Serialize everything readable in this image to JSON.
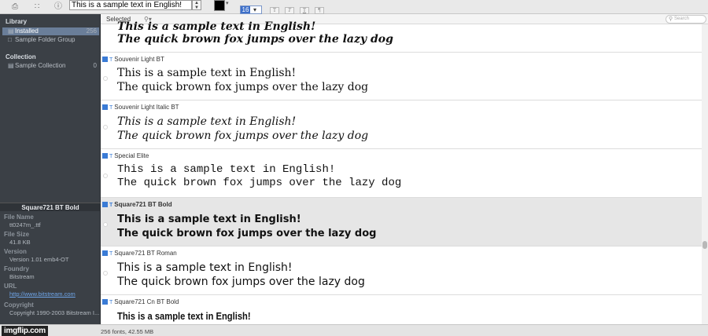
{
  "toolbar": {
    "sample_text": "This is a sample text in English!",
    "font_size": "16",
    "text_color": "#000000",
    "style_buttons": [
      "T",
      "T",
      "T",
      "¶"
    ]
  },
  "sidebar": {
    "library_heading": "Library",
    "library_items": [
      {
        "label": "Installed",
        "count": "256"
      },
      {
        "label": "Sample Folder Group",
        "count": ""
      }
    ],
    "collection_heading": "Collection",
    "collection_items": [
      {
        "label": "Sample Collection",
        "count": "0"
      }
    ]
  },
  "font_info": {
    "title": "Square721 BT Bold",
    "file_name_label": "File Name",
    "file_name": "tt0247m_.ttf",
    "file_size_label": "File Size",
    "file_size": "41.8 KB",
    "version_label": "Version",
    "version": "Version 1.01 emb4-OT",
    "foundry_label": "Foundry",
    "foundry": "Bitstream",
    "url_label": "URL",
    "url": "http://www.bitstream.com",
    "copyright_label": "Copyright",
    "copyright": "Copyright 1990-2003 Bitstream I..."
  },
  "list": {
    "selected_label": "Selected",
    "search_placeholder": "Search",
    "rows": [
      {
        "name": "",
        "line1": "This is a sample text in English!",
        "line2": "The quick brown fox jumps over the lazy dog"
      },
      {
        "name": "Souvenir Light BT",
        "line1": "This is a sample text in English!",
        "line2": "The quick brown fox jumps over the lazy dog"
      },
      {
        "name": "Souvenir Light Italic BT",
        "line1": "This is a sample text in English!",
        "line2": "The quick brown fox jumps over the lazy dog"
      },
      {
        "name": "Special Elite",
        "line1": "This is a sample text in English!",
        "line2": "The quick brown fox jumps over the lazy dog"
      },
      {
        "name": "Square721 BT Bold",
        "line1": "This is a sample text in English!",
        "line2": "The quick brown fox jumps over the lazy dog"
      },
      {
        "name": "Square721 BT Roman",
        "line1": "This is a sample text in English!",
        "line2": "The quick brown fox jumps over the lazy dog"
      },
      {
        "name": "Square721 Cn BT Bold",
        "line1": "This is a sample text in English!",
        "line2": ""
      }
    ]
  },
  "status": {
    "summary": "256 fonts, 42.55 MB",
    "watermark": "imgflip.com"
  }
}
